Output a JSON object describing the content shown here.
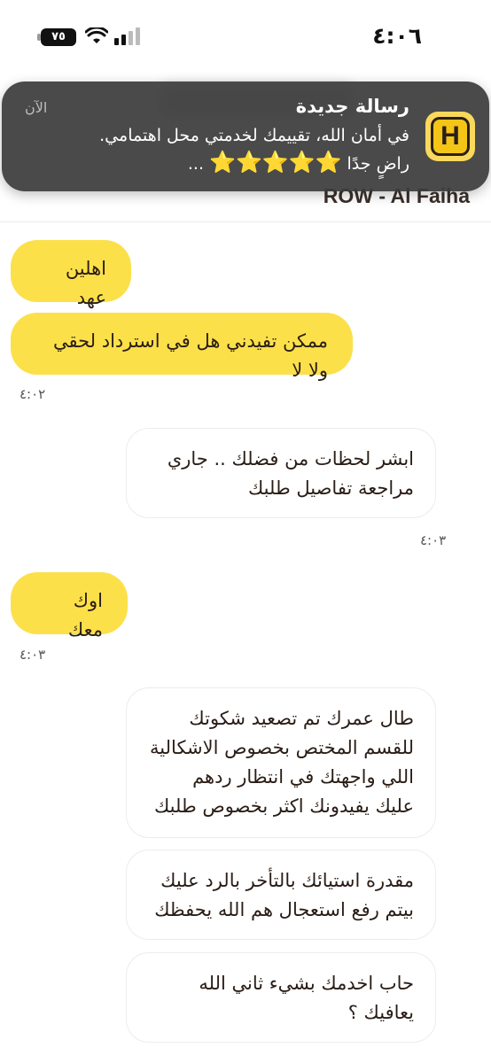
{
  "status_bar": {
    "time": "٤:٠٦",
    "battery": "٧٥"
  },
  "chat": {
    "subtitle": "ROW - Al Faiha"
  },
  "notification": {
    "title": "رسالة جديدة",
    "time": "الآن",
    "body_line1": "في أمان الله، تقييمك لخدمتي محل اهتمامي.",
    "body_line2_prefix": "راضٍ جدًا",
    "stars": "⭐⭐⭐⭐⭐",
    "body_line2_suffix": "...",
    "app_icon_letter": "H"
  },
  "messages": [
    {
      "sender": "me",
      "text": "اهلين عهد"
    },
    {
      "sender": "me",
      "text": "ممكن تفيدني هل في استرداد لحقي ولا لا",
      "time": "٤:٠٢"
    },
    {
      "sender": "agent",
      "text": "ابشر لحظات من فضلك .. جاري مراجعة تفاصيل طلبك",
      "time": "٤:٠٣"
    },
    {
      "sender": "me",
      "text": "اوك معك",
      "time": "٤:٠٣"
    },
    {
      "sender": "agent",
      "text": "طال عمرك تم تصعيد شكوتك للقسم المختص بخصوص الاشكالية اللي واجهتك في انتظار ردهم عليك يفيدونك اكثر بخصوص طلبك"
    },
    {
      "sender": "agent",
      "text": "مقدرة استيائك بالتأخر بالرد عليك بيتم رفع استعجال هم الله يحفظك"
    },
    {
      "sender": "agent",
      "text": "حاب اخدمك بشيء ثاني الله يعافيك ؟"
    }
  ],
  "colors": {
    "my_bubble": "#fbe04a",
    "agent_bubble": "#ffffff",
    "notification_bg": "#3c3c3c",
    "star": "#f6c233"
  }
}
